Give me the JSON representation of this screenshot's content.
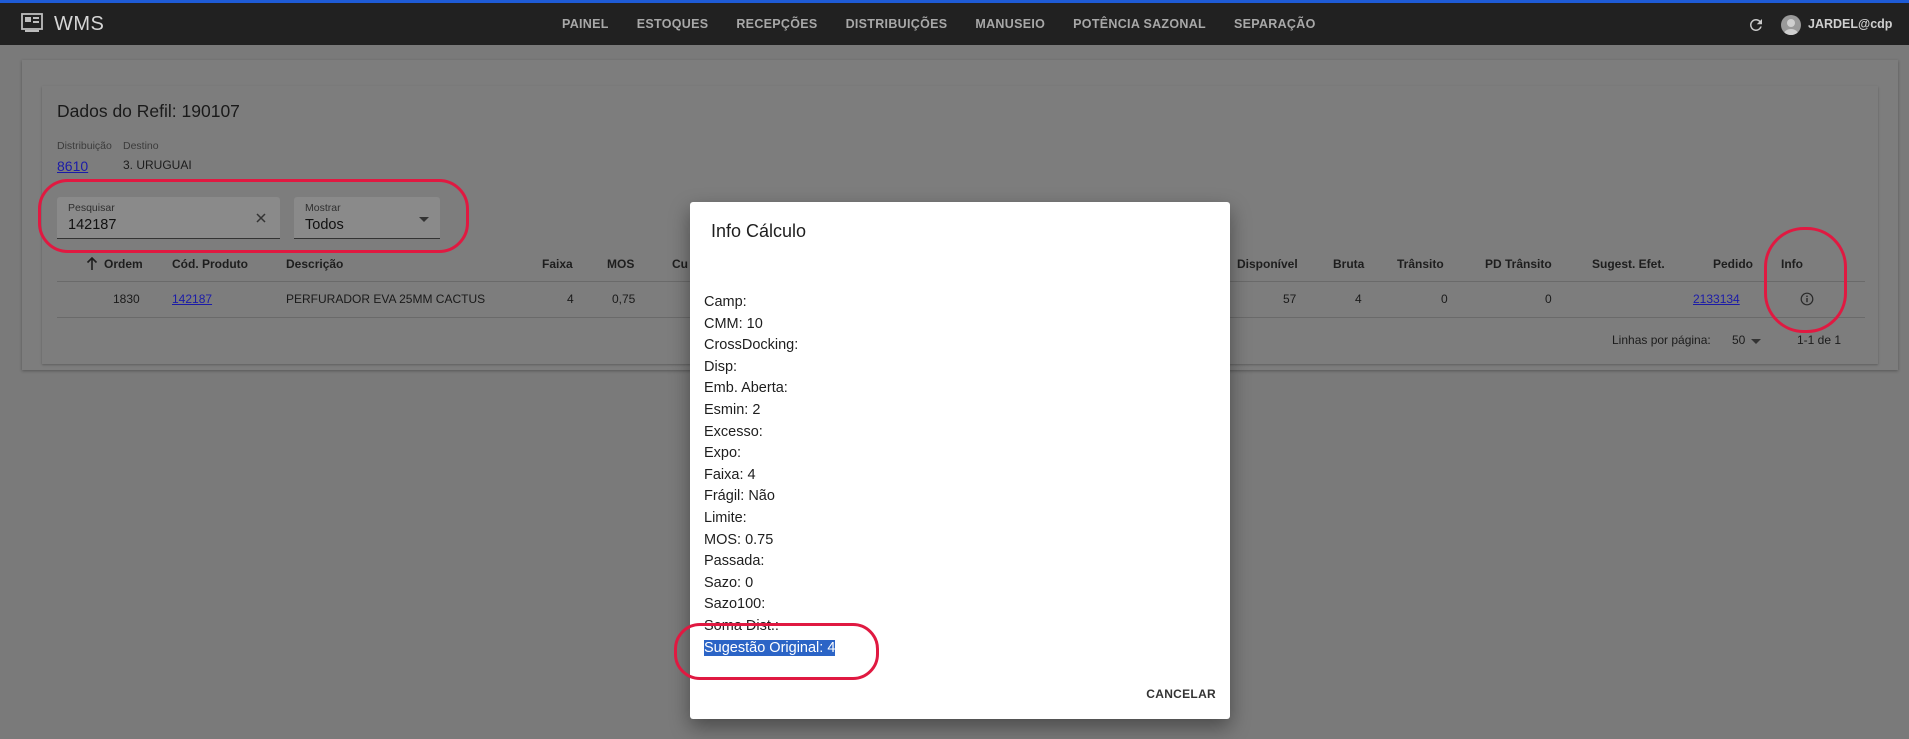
{
  "topbar": {
    "brand": "WMS",
    "nav": [
      "PAINEL",
      "ESTOQUES",
      "RECEPÇÕES",
      "DISTRIBUIÇÕES",
      "MANUSEIO",
      "POTÊNCIA SAZONAL",
      "SEPARAÇÃO"
    ],
    "user": "JARDEL@cdp"
  },
  "refil": {
    "title": "Dados do Refil: 190107",
    "distribuicao_label": "Distribuição",
    "distribuicao_value": "8610",
    "destino_label": "Destino",
    "destino_value": "3. URUGUAI"
  },
  "filters": {
    "search_label": "Pesquisar",
    "search_value": "142187",
    "show_label": "Mostrar",
    "show_value": "Todos"
  },
  "table": {
    "headers": {
      "ordem": "Ordem",
      "cod": "Cód. Produto",
      "desc": "Descrição",
      "faixa": "Faixa",
      "mos": "MOS",
      "cu": "Cu",
      "disponivel": "Disponível",
      "bruta": "Bruta",
      "transito": "Trânsito",
      "pd_transito": "PD Trânsito",
      "sugest": "Sugest. Efet.",
      "pedido": "Pedido",
      "info": "Info"
    },
    "row": {
      "ordem": "1830",
      "cod": "142187",
      "desc": "PERFURADOR EVA 25MM CACTUS",
      "faixa": "4",
      "mos": "0,75",
      "disponivel": "57",
      "bruta": "4",
      "transito": "0",
      "pd_transito": "0",
      "sugest": "",
      "pedido": "2133134"
    },
    "footer": {
      "rows_per_page_label": "Linhas por página:",
      "rows_per_page": "50",
      "range": "1-1 de 1"
    }
  },
  "dialog": {
    "title": "Info Cálculo",
    "lines": [
      "Camp:",
      "CMM: 10",
      "CrossDocking:",
      "Disp:",
      "Emb. Aberta:",
      "Esmin: 2",
      "Excesso:",
      "Expo:",
      "Faixa: 4",
      "Frágil: Não",
      "Limite:",
      "MOS: 0.75",
      "Passada:",
      "Sazo: 0",
      "Sazo100:",
      "Soma Dist.:",
      "Sugestão Original: 4"
    ],
    "cancel_label": "CANCELAR"
  },
  "colors": {
    "topbar": "#212121",
    "accent": "#1e5bd6",
    "annotation": "#e01941",
    "selection": "#2b64c6",
    "link": "#1b1ba8"
  }
}
